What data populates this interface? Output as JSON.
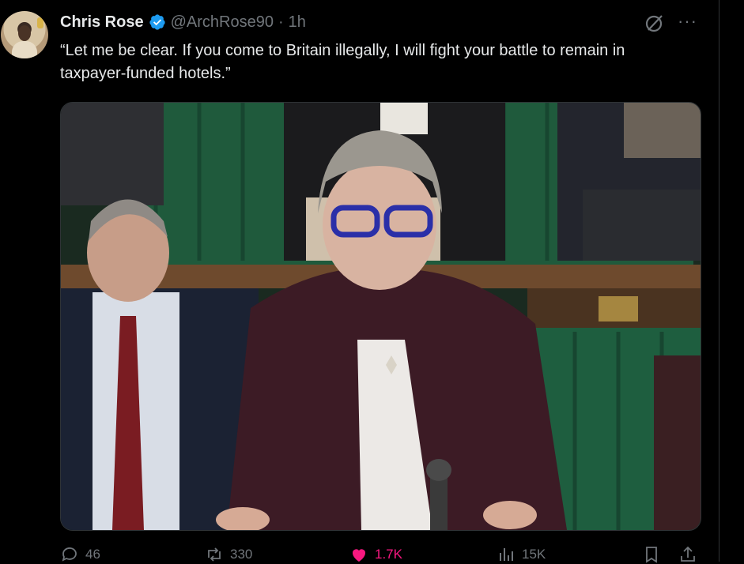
{
  "tweet": {
    "author_name": "Chris Rose",
    "handle": "@ArchRose90",
    "separator": "·",
    "time": "1h",
    "text": "“Let me be clear. If you come to Britain illegally, I will fight your battle to remain in taxpayer-funded hotels.”",
    "verified": true,
    "more_label": "···"
  },
  "media": {
    "kind": "photo",
    "scene": "parliament chamber"
  },
  "actions": {
    "replies": "46",
    "reposts": "330",
    "likes": "1.7K",
    "views": "15K"
  },
  "colors": {
    "background": "#000000",
    "text": "#e7e9ea",
    "secondary": "#71767b",
    "verified": "#1d9bf0",
    "like": "#f91880"
  },
  "icons": [
    "avatar",
    "verified-badge-icon",
    "grok-icon",
    "more-icon",
    "reply-icon",
    "repost-icon",
    "like-icon",
    "views-icon",
    "bookmark-icon",
    "share-icon"
  ]
}
